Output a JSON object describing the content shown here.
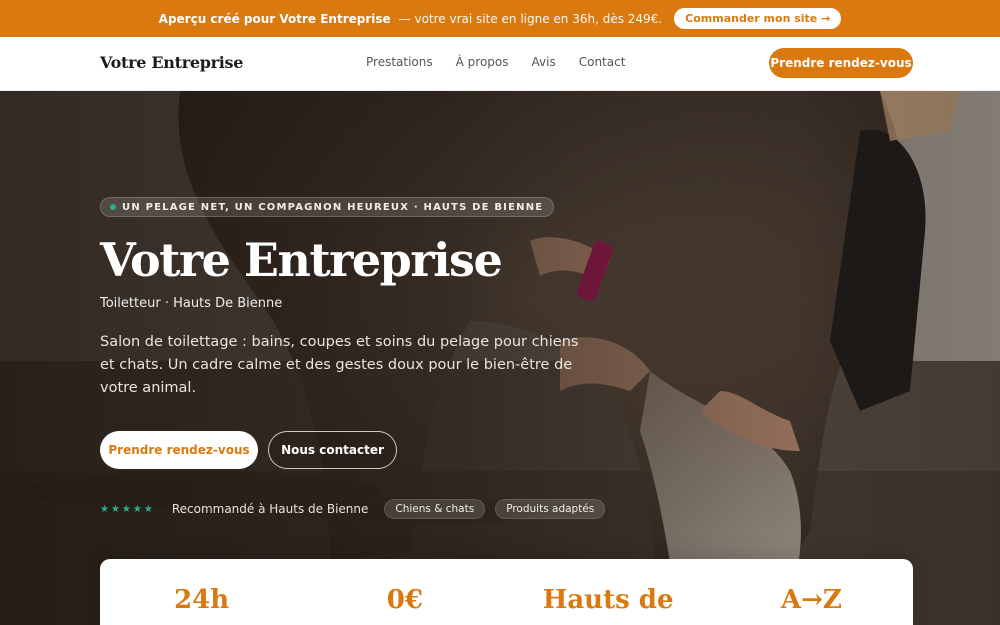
{
  "promo": {
    "strong": "Aperçu créé pour Votre Entreprise",
    "rest": "— votre vrai site en ligne en 36h, dès 249€.",
    "button": "Commander mon site →"
  },
  "header": {
    "brand": "Votre Entreprise",
    "nav": [
      "Prestations",
      "À propos",
      "Avis",
      "Contact"
    ],
    "cta": "Prendre rendez-vous"
  },
  "hero": {
    "eyebrow": "UN PELAGE NET, UN COMPAGNON HEUREUX · HAUTS DE BIENNE",
    "title": "Votre Entreprise",
    "subtitle": "Toiletteur · Hauts De Bienne",
    "description": "Salon de toilettage : bains, coupes et soins du pelage pour chiens et chats. Un cadre calme et des gestes doux pour le bien-être de votre animal.",
    "primary_button": "Prendre rendez-vous",
    "secondary_button": "Nous contacter",
    "stars": "★★★★★",
    "recommendation": "Recommandé à Hauts de Bienne",
    "pills": [
      "Chiens & chats",
      "Produits adaptés"
    ]
  },
  "stats": [
    "24h",
    "0€",
    "Hauts de",
    "A→Z"
  ],
  "colors": {
    "accent": "#d9790f",
    "star": "#2fae8f"
  }
}
